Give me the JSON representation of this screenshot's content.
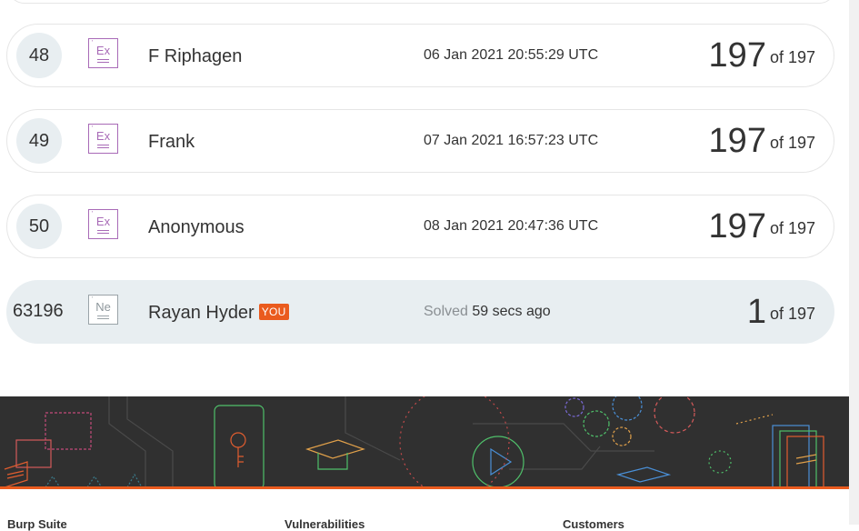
{
  "leaderboard": {
    "rows": [
      {
        "rank": "48",
        "element_symbol": "Ex",
        "element_color": "#a86ab7",
        "name": "F Riphagen",
        "date": "06 Jan 2021 20:55:29 UTC",
        "score": "197",
        "of_text": "of 197"
      },
      {
        "rank": "49",
        "element_symbol": "Ex",
        "element_color": "#a86ab7",
        "name": "Frank",
        "date": "07 Jan 2021 16:57:23 UTC",
        "score": "197",
        "of_text": "of 197"
      },
      {
        "rank": "50",
        "element_symbol": "Ex",
        "element_color": "#a86ab7",
        "name": "Anonymous",
        "date": "08 Jan 2021 20:47:36 UTC",
        "score": "197",
        "of_text": "of 197"
      }
    ],
    "current_user": {
      "rank": "63196",
      "element_symbol": "Ne",
      "element_color": "#9aa3a8",
      "name": "Rayan Hyder",
      "you_badge": "YOU",
      "solved_label": "Solved",
      "solved_time": "59 secs ago",
      "score": "1",
      "of_text": "of 197"
    }
  },
  "footer": {
    "accent_color": "#ea5b1e",
    "columns": [
      "Burp Suite",
      "Vulnerabilities",
      "Customers"
    ]
  }
}
